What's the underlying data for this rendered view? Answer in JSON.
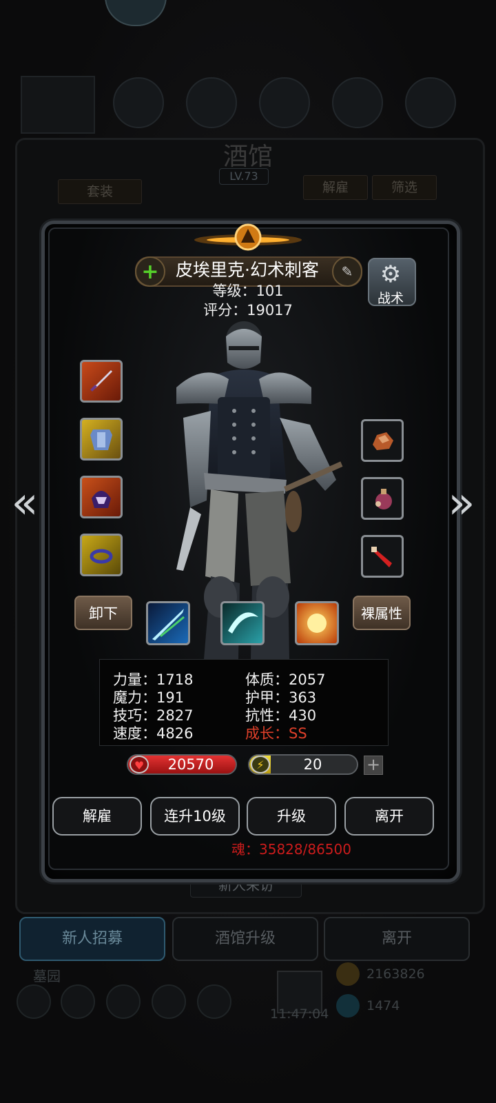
{
  "background": {
    "title": "酒馆",
    "level": "LV.73",
    "tabs": [
      "套装",
      "解雇",
      "筛选"
    ],
    "news": "新人来访",
    "buttons": [
      "新人招募",
      "酒馆升级",
      "离开"
    ],
    "bottom_label": "墓园",
    "gold": "2163826",
    "gems": "1474",
    "clock": "11:47:04"
  },
  "hero": {
    "name": "皮埃里克·幻术刺客",
    "level_line": "等级：101",
    "score_line": "评分：19017",
    "tactics_label": "战术"
  },
  "equipment_left": [
    "dagger-icon",
    "armor-icon",
    "helmet-icon",
    "ring-icon"
  ],
  "equipment_right": [
    "ore-icon",
    "potion-icon",
    "red-blade-icon"
  ],
  "skills": [
    "light-beam-icon",
    "wind-slash-icon",
    "fire-burst-icon"
  ],
  "actions_row": {
    "unequip": "卸下",
    "base_attrs": "裸属性"
  },
  "attributes": {
    "strength": "力量：1718",
    "magic": "魔力：191",
    "skill": "技巧：2827",
    "speed": "速度：4826",
    "constitution": "体质：2057",
    "armor": "护甲：363",
    "resist": "抗性：430",
    "growth": "成长：SS"
  },
  "hp": "20570",
  "energy": {
    "value": "20",
    "fill_fraction": 0.2
  },
  "buttons": {
    "dismiss": "解雇",
    "upgrade10": "连升10级",
    "upgrade": "升级",
    "leave": "离开"
  },
  "soul": "魂：35828/86500",
  "colors": {
    "growth": "#e0402a",
    "soul": "#cc1c1c",
    "hp": "#d42a2a",
    "energy": "#e8cf2a"
  }
}
